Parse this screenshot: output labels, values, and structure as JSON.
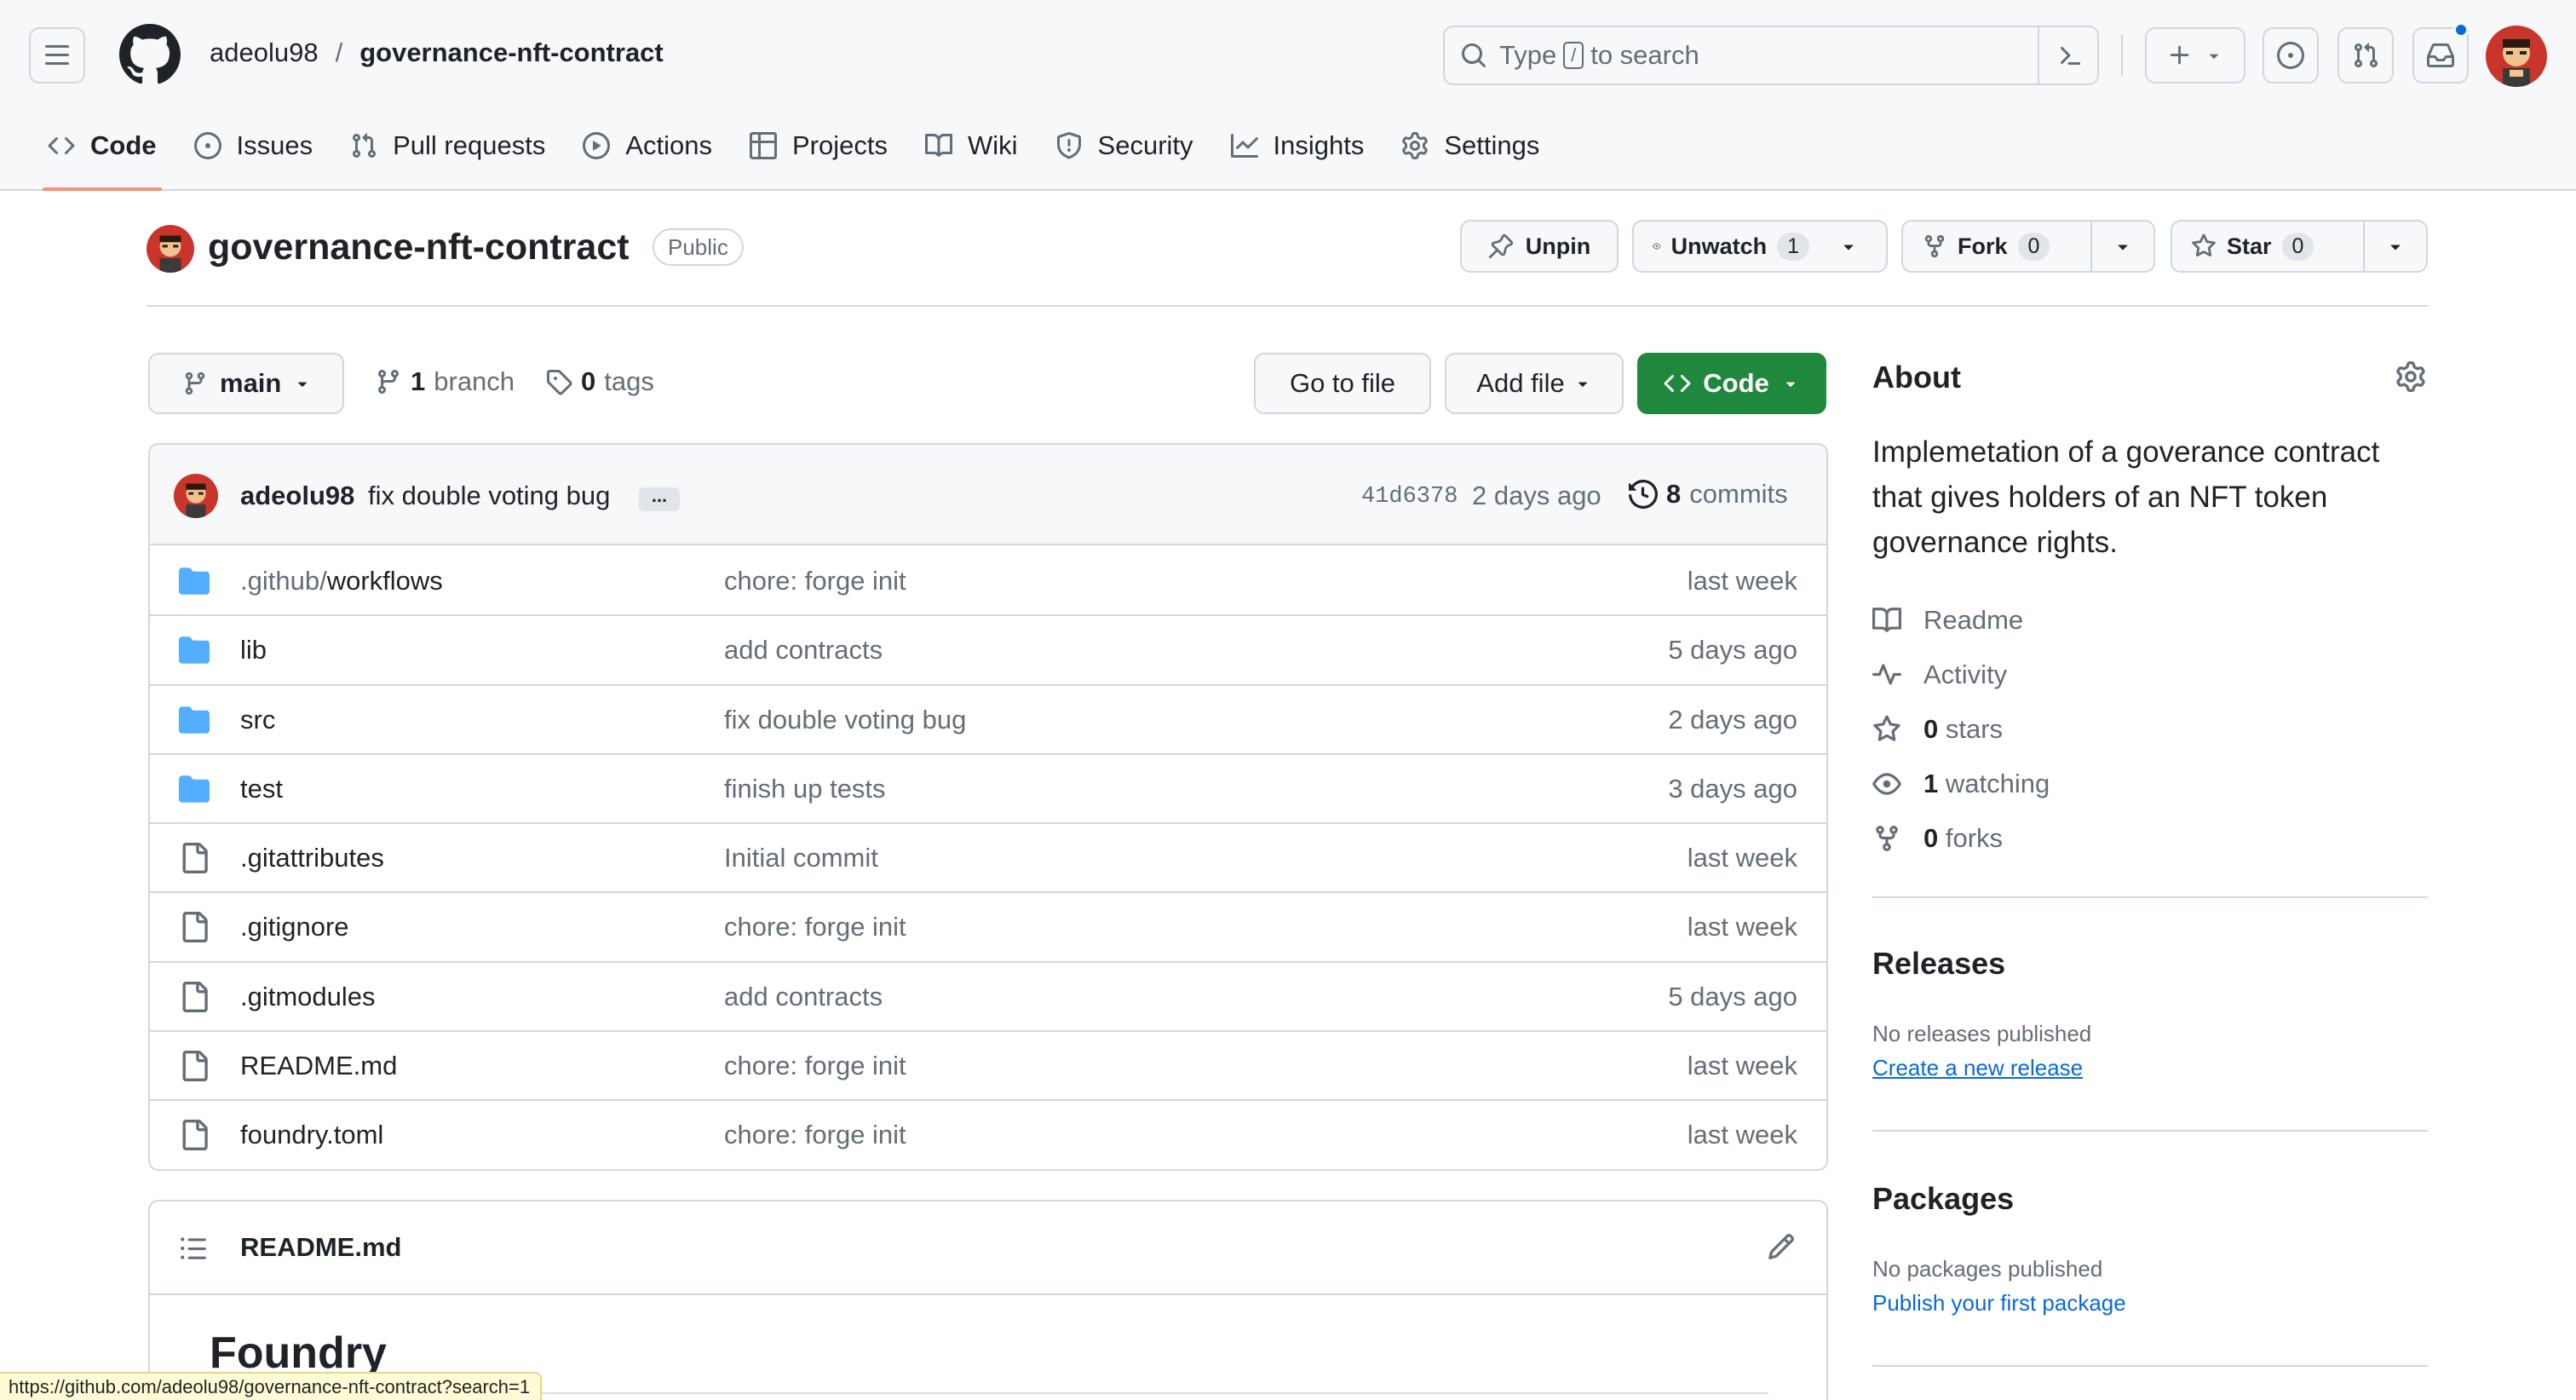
{
  "header": {
    "owner": "adeolu98",
    "separator": "/",
    "repo": "governance-nft-contract",
    "search_before": "Type",
    "search_key": "/",
    "search_after": "to search"
  },
  "tabs": [
    {
      "label": "Code",
      "icon": "code-icon"
    },
    {
      "label": "Issues",
      "icon": "issue-icon"
    },
    {
      "label": "Pull requests",
      "icon": "pull-request-icon"
    },
    {
      "label": "Actions",
      "icon": "play-icon"
    },
    {
      "label": "Projects",
      "icon": "table-icon"
    },
    {
      "label": "Wiki",
      "icon": "book-icon"
    },
    {
      "label": "Security",
      "icon": "shield-icon"
    },
    {
      "label": "Insights",
      "icon": "graph-icon"
    },
    {
      "label": "Settings",
      "icon": "gear-icon"
    }
  ],
  "repo_head": {
    "title": "governance-nft-contract",
    "visibility": "Public",
    "unpin": "Unpin",
    "unwatch": "Unwatch",
    "watch_count": "1",
    "fork": "Fork",
    "fork_count": "0",
    "star": "Star",
    "star_count": "0"
  },
  "file_nav": {
    "branch": "main",
    "branch_count": "1",
    "branch_word": "branch",
    "tag_count": "0",
    "tag_word": "tags",
    "go_to_file": "Go to file",
    "add_file": "Add file",
    "code": "Code"
  },
  "latest_commit": {
    "author": "adeolu98",
    "message": "fix double voting bug",
    "ellipsis": "...",
    "hash": "41d6378",
    "time": "2 days ago",
    "count": "8",
    "count_word": "commits"
  },
  "files": [
    {
      "type": "dir",
      "prefix": ".github/",
      "name": "workflows",
      "message": "chore: forge init",
      "time": "last week"
    },
    {
      "type": "dir",
      "prefix": "",
      "name": "lib",
      "message": "add contracts",
      "time": "5 days ago"
    },
    {
      "type": "dir",
      "prefix": "",
      "name": "src",
      "message": "fix double voting bug",
      "time": "2 days ago"
    },
    {
      "type": "dir",
      "prefix": "",
      "name": "test",
      "message": "finish up tests",
      "time": "3 days ago"
    },
    {
      "type": "file",
      "prefix": "",
      "name": ".gitattributes",
      "message": "Initial commit",
      "time": "last week"
    },
    {
      "type": "file",
      "prefix": "",
      "name": ".gitignore",
      "message": "chore: forge init",
      "time": "last week"
    },
    {
      "type": "file",
      "prefix": "",
      "name": ".gitmodules",
      "message": "add contracts",
      "time": "5 days ago"
    },
    {
      "type": "file",
      "prefix": "",
      "name": "README.md",
      "message": "chore: forge init",
      "time": "last week"
    },
    {
      "type": "file",
      "prefix": "",
      "name": "foundry.toml",
      "message": "chore: forge init",
      "time": "last week"
    }
  ],
  "readme": {
    "filename": "README.md",
    "heading": "Foundry"
  },
  "about": {
    "title": "About",
    "description": "Implemetation of a goverance contract that gives holders of an NFT token governance rights.",
    "readme": "Readme",
    "activity": "Activity",
    "stars_count": "0",
    "stars_word": "stars",
    "watching_count": "1",
    "watching_word": "watching",
    "forks_count": "0",
    "forks_word": "forks"
  },
  "releases": {
    "title": "Releases",
    "empty": "No releases published",
    "link": "Create a new release"
  },
  "packages": {
    "title": "Packages",
    "empty": "No packages published",
    "link": "Publish your first package"
  },
  "statusbar": {
    "url": "https://github.com/adeolu98/governance-nft-contract?search=1"
  },
  "colors": {
    "accent_green": "#1f883d",
    "link_blue": "#0969da",
    "tab_underline": "#fd8c73",
    "folder_blue": "#54aeff"
  }
}
